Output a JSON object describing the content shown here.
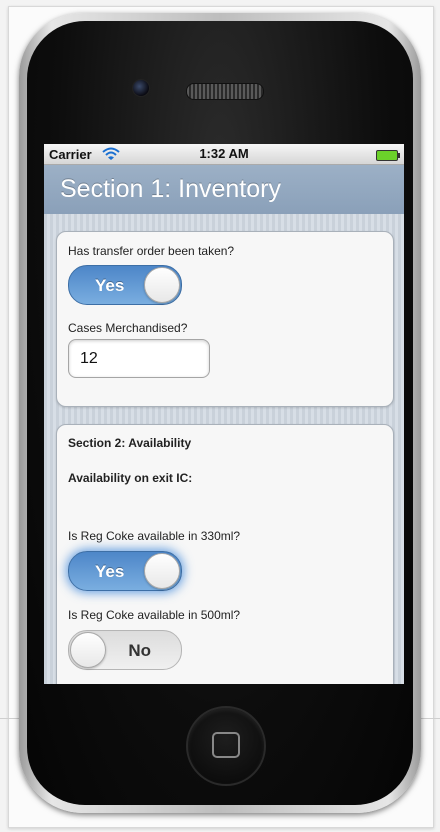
{
  "status_bar": {
    "carrier": "Carrier",
    "time": "1:32 AM"
  },
  "nav": {
    "title": "Section 1: Inventory"
  },
  "section1": {
    "transfer_question": "Has transfer order been taken?",
    "transfer_toggle": {
      "label": "Yes",
      "state": "on"
    },
    "cases_label": "Cases Merchandised?",
    "cases_value": "12"
  },
  "section2": {
    "heading": "Section 2: Availability",
    "subheading": "Availability on exit IC:",
    "q330": "Is Reg Coke available in 330ml?",
    "toggle330": {
      "label": "Yes",
      "state": "on"
    },
    "q500": "Is Reg Coke available in 500ml?",
    "toggle500": {
      "label": "No",
      "state": "off"
    }
  },
  "colors": {
    "accent": "#5b93d0",
    "nav_bar": "#8fa4bc",
    "battery": "#6bd12a"
  },
  "icons": [
    "wifi-icon",
    "battery-icon",
    "camera-icon",
    "speaker-icon",
    "home-button-icon"
  ]
}
